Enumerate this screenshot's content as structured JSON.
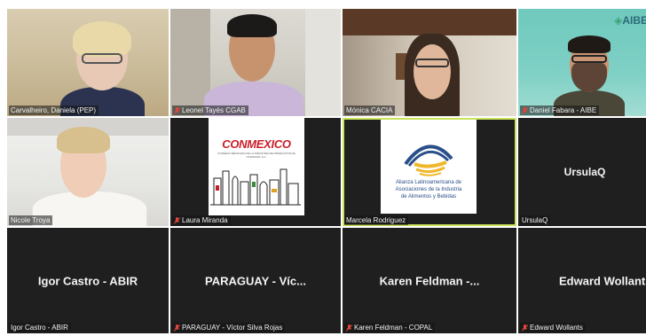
{
  "tiles": [
    {
      "name": "Carvalheiro, Daniela (PEP)",
      "muted": false
    },
    {
      "name": "Leonel Tayés CGAB",
      "muted": true
    },
    {
      "name": "Mónica CACIA",
      "muted": false
    },
    {
      "name": "Daniel Fabara - AIBE",
      "muted": true
    },
    {
      "name": "Nicole Troya",
      "muted": false
    },
    {
      "name": "Laura Miranda",
      "muted": true
    },
    {
      "name": "Marcela Rodriguez",
      "muted": false
    },
    {
      "name": "UrsulaQ",
      "muted": false,
      "display": "UrsulaQ"
    },
    {
      "name": "Igor Castro - ABIR",
      "muted": false,
      "display": "Igor Castro - ABIR"
    },
    {
      "name": "PARAGUAY - Víctor Silva Rojas",
      "muted": true,
      "display": "PARAGUAY - Víc..."
    },
    {
      "name": "Karen Feldman - COPAL",
      "muted": true,
      "display": "Karen Feldman -..."
    },
    {
      "name": "Edward Wollants",
      "muted": true,
      "display": "Edward Wollants"
    }
  ],
  "logos": {
    "conmexico": {
      "title": "CONMEXICO",
      "subtitle": "CONSEJO MEXICANO DE LA INDUSTRIA DE PRODUCTOS DE CONSUMO, A.C."
    },
    "alianza": {
      "line1": "Alianza Latinoamericana de",
      "line2": "Asociaciones de la Industria",
      "line3": "de Alimentos y Bebidas"
    },
    "aibe": "AIBE"
  },
  "colors": {
    "tile_bg": "#1f1f1f",
    "speaker_outline": "#c9e35a",
    "mute_red": "#e0463c"
  }
}
